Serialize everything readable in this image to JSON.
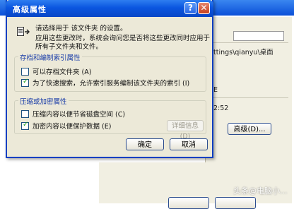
{
  "background": {
    "path_fragment": "ttings\\qianyu\\桌面",
    "fragment_e": "E",
    "time_fragment": "2:52",
    "advanced_button": "高级(D)...",
    "watermark": "头条@电脑小..."
  },
  "dialog": {
    "title": "高级属性",
    "help_label": "?",
    "close_label": "✕",
    "intro_line1": "请选择用于 该文件夹 的设置。",
    "intro_line2": "应用这些更改时，系统会询问您是否将这些更改同时应用于",
    "intro_line3": "所有子文件夹和文件。",
    "archive_group": {
      "label": "存档和编制索引属性",
      "items": [
        {
          "label": "可以存档文件夹 (A)",
          "checked": false
        },
        {
          "label": "为了快速搜索，允许索引服务编制该文件夹的索引 (I)",
          "checked": true
        }
      ]
    },
    "compress_group": {
      "label": "压缩或加密属性",
      "items": [
        {
          "label": "压缩内容以便节省磁盘空间 (C)",
          "checked": false
        },
        {
          "label": "加密内容以便保护数据 (E)",
          "checked": true
        }
      ],
      "details_button": "详细信息 (D)"
    },
    "ok_button": "确定",
    "cancel_button": "取消"
  },
  "colors": {
    "title_blue": "#0b56e0",
    "dialog_face": "#ece9d8",
    "group_label": "#1b3ea8",
    "check_green": "#21a121"
  }
}
